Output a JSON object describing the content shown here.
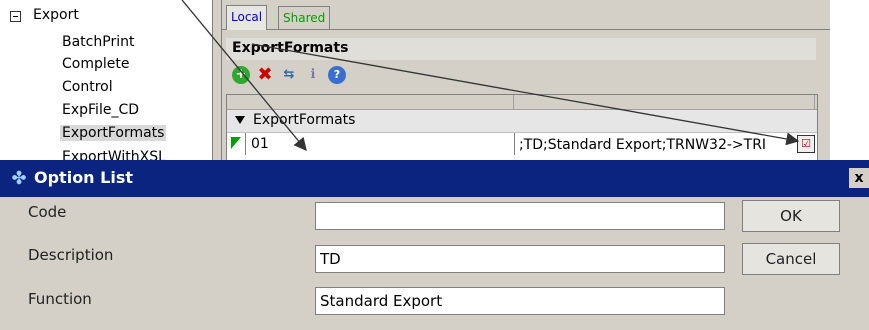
{
  "tree": {
    "root_label": "Export",
    "children": [
      "BatchPrint",
      "Complete",
      "Control",
      "ExpFile_CD",
      "ExportFormats",
      "ExportWithXSL"
    ],
    "selected_index": 4
  },
  "tabs": [
    {
      "label": "Local",
      "color": "#0000cc"
    },
    {
      "label": "Shared",
      "color": "#00a000"
    }
  ],
  "section": {
    "title": "ExportFormats"
  },
  "toolbar": {
    "icons": [
      "add-icon",
      "delete-icon",
      "move-icon",
      "info-icon",
      "help-icon"
    ]
  },
  "grid": {
    "group_label": "ExportFormats",
    "row": {
      "code": "01",
      "description": ";TD;Standard Export;TRNW32->TRI"
    }
  },
  "dialog": {
    "title": "Option List",
    "close_label": "x",
    "fields": [
      {
        "label": "Code",
        "value": ""
      },
      {
        "label": "Description",
        "value": "TD"
      },
      {
        "label": "Function",
        "value": "Standard Export"
      }
    ],
    "ok_label": "OK",
    "cancel_label": "Cancel"
  },
  "colors": {
    "titlebar": "#0b2480",
    "panel": "#d4d0c8",
    "selection": "#d9d9d9"
  }
}
